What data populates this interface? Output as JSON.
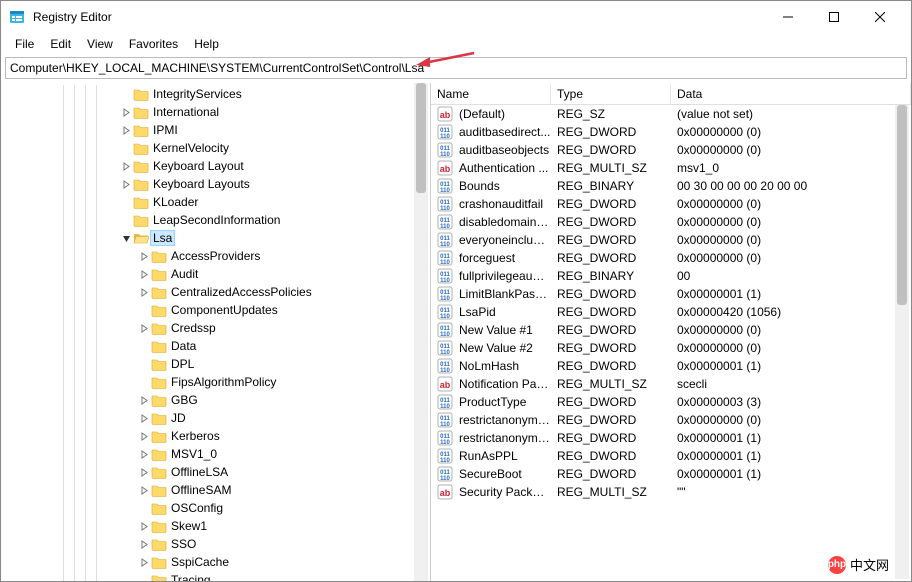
{
  "window": {
    "title": "Registry Editor"
  },
  "menus": [
    "File",
    "Edit",
    "View",
    "Favorites",
    "Help"
  ],
  "address": "Computer\\HKEY_LOCAL_MACHINE\\SYSTEM\\CurrentControlSet\\Control\\Lsa",
  "tree": [
    {
      "depth": 5,
      "label": "IntegrityServices",
      "exp": ""
    },
    {
      "depth": 5,
      "label": "International",
      "exp": ">"
    },
    {
      "depth": 5,
      "label": "IPMI",
      "exp": ">"
    },
    {
      "depth": 5,
      "label": "KernelVelocity",
      "exp": ""
    },
    {
      "depth": 5,
      "label": "Keyboard Layout",
      "exp": ">"
    },
    {
      "depth": 5,
      "label": "Keyboard Layouts",
      "exp": ">"
    },
    {
      "depth": 5,
      "label": "KLoader",
      "exp": ""
    },
    {
      "depth": 5,
      "label": "LeapSecondInformation",
      "exp": ""
    },
    {
      "depth": 5,
      "label": "Lsa",
      "exp": "v",
      "selected": true,
      "open": true
    },
    {
      "depth": 6,
      "label": "AccessProviders",
      "exp": ">"
    },
    {
      "depth": 6,
      "label": "Audit",
      "exp": ">"
    },
    {
      "depth": 6,
      "label": "CentralizedAccessPolicies",
      "exp": ">"
    },
    {
      "depth": 6,
      "label": "ComponentUpdates",
      "exp": ""
    },
    {
      "depth": 6,
      "label": "Credssp",
      "exp": ">"
    },
    {
      "depth": 6,
      "label": "Data",
      "exp": ""
    },
    {
      "depth": 6,
      "label": "DPL",
      "exp": ""
    },
    {
      "depth": 6,
      "label": "FipsAlgorithmPolicy",
      "exp": ""
    },
    {
      "depth": 6,
      "label": "GBG",
      "exp": ">"
    },
    {
      "depth": 6,
      "label": "JD",
      "exp": ">"
    },
    {
      "depth": 6,
      "label": "Kerberos",
      "exp": ">"
    },
    {
      "depth": 6,
      "label": "MSV1_0",
      "exp": ">"
    },
    {
      "depth": 6,
      "label": "OfflineLSA",
      "exp": ">"
    },
    {
      "depth": 6,
      "label": "OfflineSAM",
      "exp": ">"
    },
    {
      "depth": 6,
      "label": "OSConfig",
      "exp": ""
    },
    {
      "depth": 6,
      "label": "Skew1",
      "exp": ">"
    },
    {
      "depth": 6,
      "label": "SSO",
      "exp": ">"
    },
    {
      "depth": 6,
      "label": "SspiCache",
      "exp": ">"
    },
    {
      "depth": 6,
      "label": "Tracing",
      "exp": ""
    }
  ],
  "columns": {
    "name": "Name",
    "type": "Type",
    "data": "Data"
  },
  "values": [
    {
      "icon": "sz",
      "name": "(Default)",
      "type": "REG_SZ",
      "data": "(value not set)"
    },
    {
      "icon": "bin",
      "name": "auditbasedirect...",
      "type": "REG_DWORD",
      "data": "0x00000000 (0)"
    },
    {
      "icon": "bin",
      "name": "auditbaseobjects",
      "type": "REG_DWORD",
      "data": "0x00000000 (0)"
    },
    {
      "icon": "sz",
      "name": "Authentication ...",
      "type": "REG_MULTI_SZ",
      "data": "msv1_0"
    },
    {
      "icon": "bin",
      "name": "Bounds",
      "type": "REG_BINARY",
      "data": "00 30 00 00 00 20 00 00"
    },
    {
      "icon": "bin",
      "name": "crashonauditfail",
      "type": "REG_DWORD",
      "data": "0x00000000 (0)"
    },
    {
      "icon": "bin",
      "name": "disabledomainc...",
      "type": "REG_DWORD",
      "data": "0x00000000 (0)"
    },
    {
      "icon": "bin",
      "name": "everyoneinclude...",
      "type": "REG_DWORD",
      "data": "0x00000000 (0)"
    },
    {
      "icon": "bin",
      "name": "forceguest",
      "type": "REG_DWORD",
      "data": "0x00000000 (0)"
    },
    {
      "icon": "bin",
      "name": "fullprivilegeaudi...",
      "type": "REG_BINARY",
      "data": "00"
    },
    {
      "icon": "bin",
      "name": "LimitBlankPass...",
      "type": "REG_DWORD",
      "data": "0x00000001 (1)"
    },
    {
      "icon": "bin",
      "name": "LsaPid",
      "type": "REG_DWORD",
      "data": "0x00000420 (1056)"
    },
    {
      "icon": "bin",
      "name": "New Value #1",
      "type": "REG_DWORD",
      "data": "0x00000000 (0)"
    },
    {
      "icon": "bin",
      "name": "New Value #2",
      "type": "REG_DWORD",
      "data": "0x00000000 (0)"
    },
    {
      "icon": "bin",
      "name": "NoLmHash",
      "type": "REG_DWORD",
      "data": "0x00000001 (1)"
    },
    {
      "icon": "sz",
      "name": "Notification Pac...",
      "type": "REG_MULTI_SZ",
      "data": "scecli"
    },
    {
      "icon": "bin",
      "name": "ProductType",
      "type": "REG_DWORD",
      "data": "0x00000003 (3)"
    },
    {
      "icon": "bin",
      "name": "restrictanonymo...",
      "type": "REG_DWORD",
      "data": "0x00000000 (0)"
    },
    {
      "icon": "bin",
      "name": "restrictanonymo...",
      "type": "REG_DWORD",
      "data": "0x00000001 (1)"
    },
    {
      "icon": "bin",
      "name": "RunAsPPL",
      "type": "REG_DWORD",
      "data": "0x00000001 (1)"
    },
    {
      "icon": "bin",
      "name": "SecureBoot",
      "type": "REG_DWORD",
      "data": "0x00000001 (1)"
    },
    {
      "icon": "sz",
      "name": "Security Packages",
      "type": "REG_MULTI_SZ",
      "data": "\"\""
    }
  ],
  "watermark": {
    "text": "中文网",
    "prefix": "php"
  }
}
